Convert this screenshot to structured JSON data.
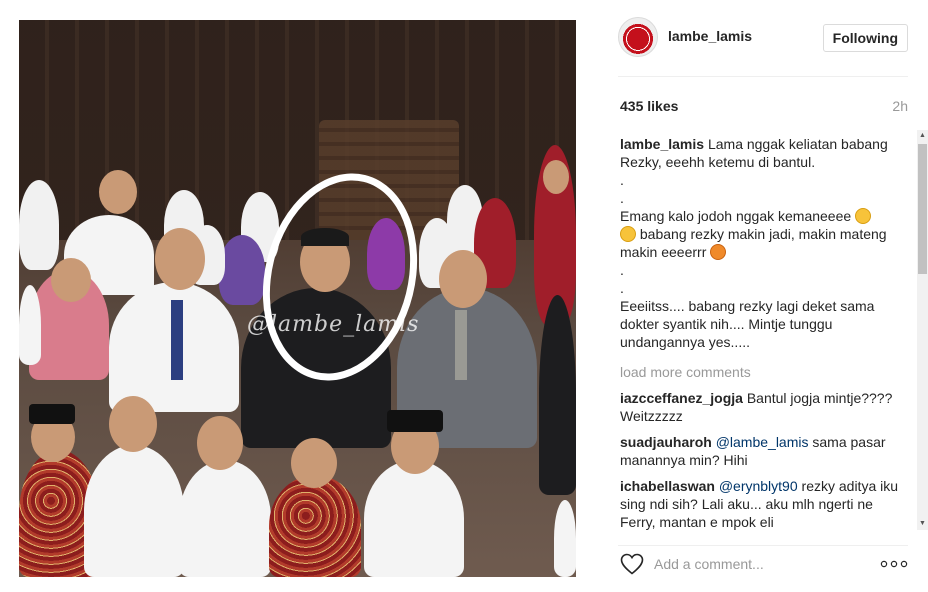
{
  "post": {
    "username": "lambe_lamis",
    "follow_label": "Following",
    "likes": "435 likes",
    "time": "2h",
    "watermark": "@lambe_lamis"
  },
  "caption": {
    "username": "lambe_lamis",
    "line1": "Lama nggak keliatan babang Rezky, eeehh ketemu di bantul.",
    "dot1": ".",
    "dot2": ".",
    "line2a": "Emang kalo jodoh nggak kemaneeee",
    "line2b": "babang rezky makin jadi, makin mateng makin eeeerrr",
    "dot3": ".",
    "dot4": ".",
    "line3": "Eeeiitss.... babang rezky lagi deket sama dokter syantik nih.... Mintje tunggu undangannya yes....."
  },
  "load_more": "load more comments",
  "comments": [
    {
      "user": "iazcceffanez_jogja",
      "mention": "",
      "text": "Bantul jogja mintje???? Weitzzzzz"
    },
    {
      "user": "suadjauharoh",
      "mention": "@lambe_lamis",
      "text": "sama pasar manannya min? Hihi"
    },
    {
      "user": "ichabellaswan",
      "mention": "@erynblyt90",
      "text": "rezky aditya iku sing ndi sih? Lali aku... aku mlh ngerti ne Ferry, mantan e mpok eli"
    }
  ],
  "add_comment_placeholder": "Add a comment...",
  "icons": {
    "avatar": "lips-avatar",
    "like": "heart-icon",
    "more": "more-options-icon",
    "emoji_smile": "grinning-face-emoji",
    "emoji_tiger": "tiger-face-emoji"
  },
  "colors": {
    "text": "#262626",
    "muted": "#999999",
    "mention": "#003569",
    "border": "#dbdbdb"
  }
}
